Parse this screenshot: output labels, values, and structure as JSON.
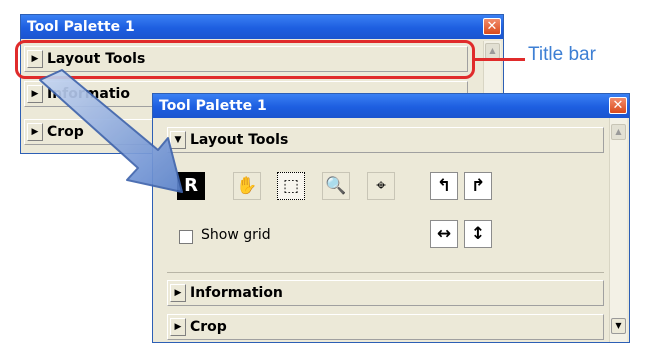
{
  "back_palette": {
    "title": "Tool Palette 1",
    "close_glyph": "✕",
    "sections": [
      {
        "label": "Layout Tools",
        "arrow": "▶"
      },
      {
        "label": "Informatio",
        "arrow": "▶"
      },
      {
        "label": "Crop",
        "arrow": "▶"
      }
    ]
  },
  "front_palette": {
    "title": "Tool Palette 1",
    "close_glyph": "✕",
    "layout_section": {
      "label": "Layout Tools",
      "arrow": "▼"
    },
    "tools": {
      "r_badge": "R",
      "hand": "✋",
      "marquee": "⬚",
      "zoom": "🔍",
      "crosshair": "⌖",
      "rotate_left": "↰",
      "rotate_right": "↱",
      "flip_horizontal": "↔",
      "flip_vertical": "↕"
    },
    "show_grid_label": "Show grid",
    "info_section": {
      "label": "Information",
      "arrow": "▶"
    },
    "crop_section": {
      "label": "Crop",
      "arrow": "▶"
    },
    "scroll_up_glyph": "▲",
    "scroll_down_glyph": "▼"
  },
  "callout": {
    "label": "Title bar",
    "color": "#3d7fd4",
    "highlight_color": "#e02b2b"
  }
}
